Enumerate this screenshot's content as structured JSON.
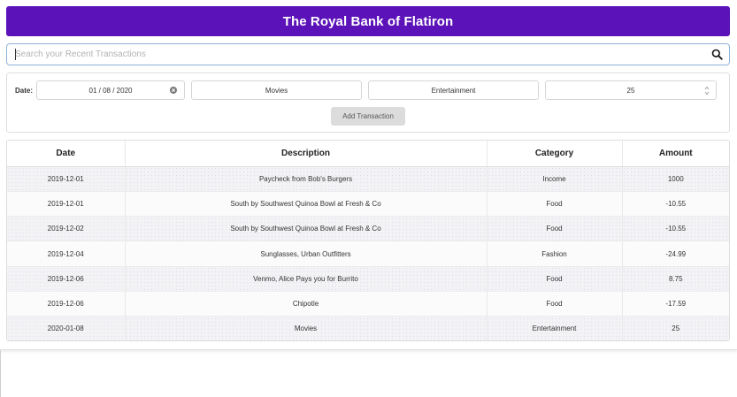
{
  "header": {
    "title": "The Royal Bank of Flatiron"
  },
  "search": {
    "placeholder": "Search your Recent Transactions",
    "value": ""
  },
  "form": {
    "date_label": "Date:",
    "date_value": "01 / 08 / 2020",
    "description_value": "Movies",
    "category_value": "Entertainment",
    "amount_value": "25",
    "add_button_label": "Add Transaction"
  },
  "table": {
    "headers": [
      "Date",
      "Description",
      "Category",
      "Amount"
    ],
    "rows": [
      [
        "2019-12-01",
        "Paycheck from Bob's Burgers",
        "Income",
        "1000"
      ],
      [
        "2019-12-01",
        "South by Southwest Quinoa Bowl at Fresh & Co",
        "Food",
        "-10.55"
      ],
      [
        "2019-12-02",
        "South by Southwest Quinoa Bowl at Fresh & Co",
        "Food",
        "-10.55"
      ],
      [
        "2019-12-04",
        "Sunglasses, Urban Outfitters",
        "Fashion",
        "-24.99"
      ],
      [
        "2019-12-06",
        "Venmo, Alice Pays you for Burrito",
        "Food",
        "8.75"
      ],
      [
        "2019-12-06",
        "Chipotle",
        "Food",
        "-17.59"
      ],
      [
        "2020-01-08",
        "Movies",
        "Entertainment",
        "25"
      ]
    ]
  },
  "colors": {
    "header_bg": "#5b12b8",
    "search_border": "#8fb3d9",
    "button_bg": "#dcdcdc"
  },
  "icons": {
    "search": "search-icon",
    "clear_date": "clear-icon",
    "amount_spinner": "spinner-icon"
  }
}
